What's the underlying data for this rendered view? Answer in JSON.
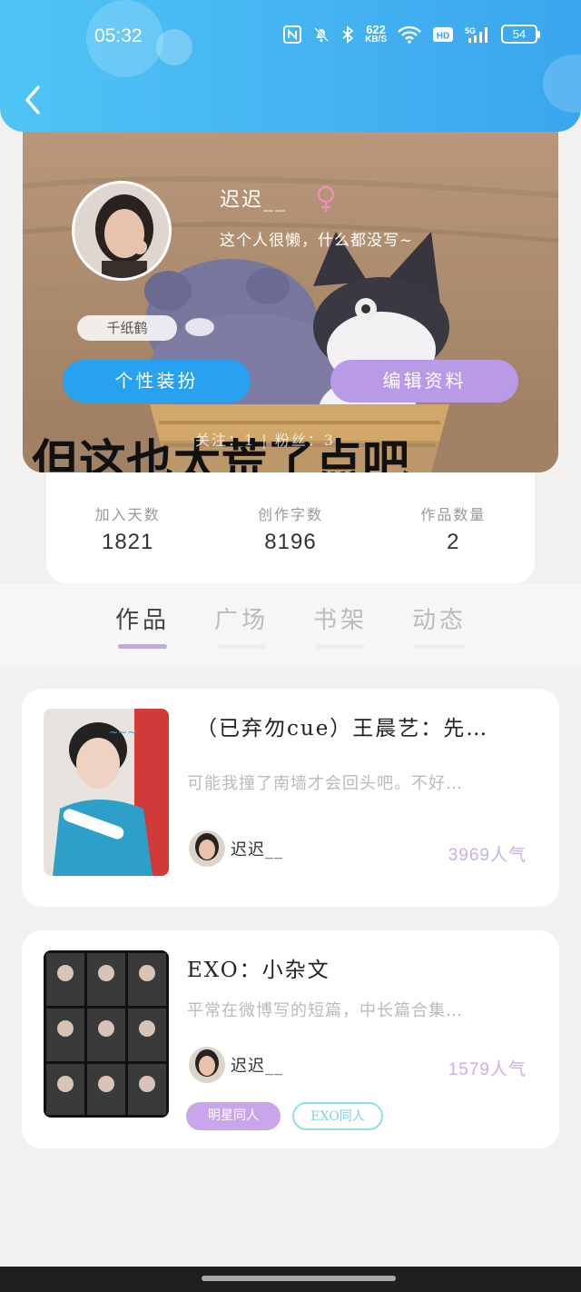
{
  "status_bar": {
    "time": "05:32",
    "net_speed_value": "622",
    "net_speed_unit": "KB/S",
    "battery": "54"
  },
  "profile": {
    "username": "迟迟__",
    "bio": "这个人很懒，什么都没写~",
    "badge": "千纸鹤",
    "dress_button": "个性装扮",
    "edit_button": "编辑资料",
    "follow_stats": "关注：1  |  粉丝：3",
    "banner_caption": "但这也太荒了点吧"
  },
  "stats": [
    {
      "label": "加入天数",
      "value": "1821"
    },
    {
      "label": "创作字数",
      "value": "8196"
    },
    {
      "label": "作品数量",
      "value": "2"
    }
  ],
  "tabs": [
    "作品",
    "广场",
    "书架",
    "动态"
  ],
  "works": [
    {
      "title": "（已弃勿cue）王晨艺：先…",
      "desc": "可能我撞了南墙才会回头吧。不好…",
      "author": "迟迟__",
      "popularity": "3969人气"
    },
    {
      "title": "EXO：小杂文",
      "desc": "平常在微博写的短篇，中长篇合集…",
      "author": "迟迟__",
      "popularity": "1579人气",
      "tags": [
        "明星同人",
        "EXO同人"
      ]
    }
  ],
  "colors": {
    "header": "#3aa6ee",
    "dress_button": "#27a2f0",
    "edit_button": "#b99ae6",
    "tab_active": "#c3a7e8"
  }
}
